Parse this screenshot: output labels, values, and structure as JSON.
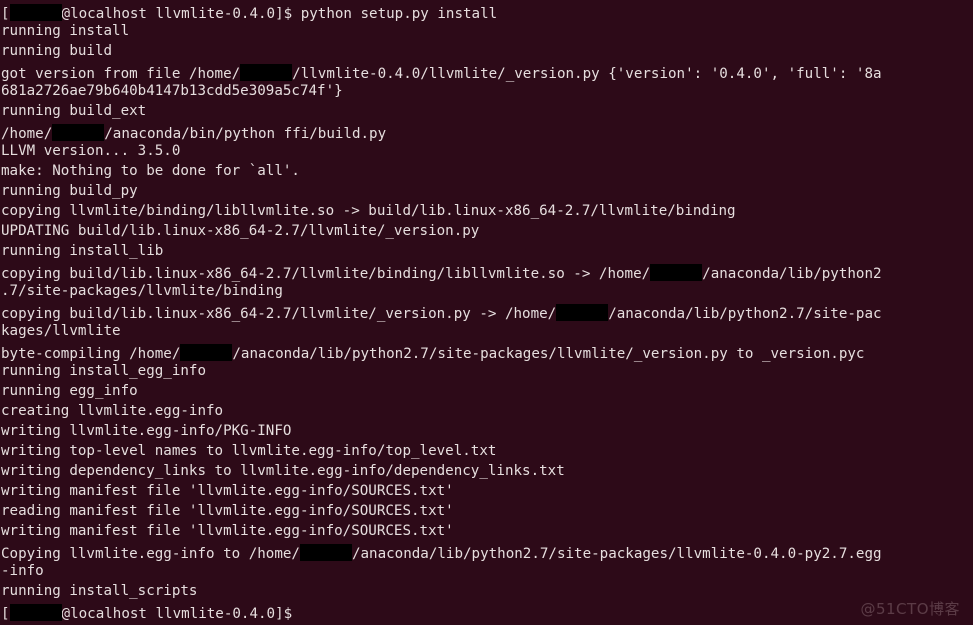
{
  "terminal": {
    "background_color": "#2d0a18",
    "text_color": "#e6dede",
    "redaction_color": "#000000",
    "hostname": "localhost",
    "working_directory": "llvmlite-0.4.0",
    "prompt_symbol": "$",
    "command": "python setup.py install",
    "font_size_px": 14,
    "line_height_px": 20,
    "columns": 107,
    "rows": 31,
    "lines": [
      {
        "id": "l01",
        "type": "prompt",
        "pre": "[",
        "redact_width": 52,
        "post": "@localhost llvmlite-0.4.0]$ python setup.py install"
      },
      {
        "id": "l02",
        "type": "output",
        "text": "running install"
      },
      {
        "id": "l03",
        "type": "output",
        "text": "running build"
      },
      {
        "id": "l04",
        "type": "output-redacted",
        "pre": "got version from file /home/",
        "redact_width": 52,
        "post": "/llvmlite-0.4.0/llvmlite/_version.py {'version': '0.4.0', 'full': '8a"
      },
      {
        "id": "l05",
        "type": "output",
        "text": "681a2726ae79b640b4147b13cdd5e309a5c74f'}"
      },
      {
        "id": "l06",
        "type": "output",
        "text": "running build_ext"
      },
      {
        "id": "l07",
        "type": "output-redacted",
        "pre": "/home/",
        "redact_width": 52,
        "post": "/anaconda/bin/python ffi/build.py"
      },
      {
        "id": "l08",
        "type": "output",
        "text": "LLVM version... 3.5.0"
      },
      {
        "id": "l09",
        "type": "output",
        "text": "make: Nothing to be done for `all'."
      },
      {
        "id": "l10",
        "type": "output",
        "text": "running build_py"
      },
      {
        "id": "l11",
        "type": "output",
        "text": "copying llvmlite/binding/libllvmlite.so -> build/lib.linux-x86_64-2.7/llvmlite/binding"
      },
      {
        "id": "l12",
        "type": "output",
        "text": "UPDATING build/lib.linux-x86_64-2.7/llvmlite/_version.py"
      },
      {
        "id": "l13",
        "type": "output",
        "text": "running install_lib"
      },
      {
        "id": "l14",
        "type": "output-redacted",
        "pre": "copying build/lib.linux-x86_64-2.7/llvmlite/binding/libllvmlite.so -> /home/",
        "redact_width": 52,
        "post": "/anaconda/lib/python2"
      },
      {
        "id": "l15",
        "type": "output",
        "text": ".7/site-packages/llvmlite/binding"
      },
      {
        "id": "l16",
        "type": "output-redacted",
        "pre": "copying build/lib.linux-x86_64-2.7/llvmlite/_version.py -> /home/",
        "redact_width": 52,
        "post": "/anaconda/lib/python2.7/site-pac"
      },
      {
        "id": "l17",
        "type": "output",
        "text": "kages/llvmlite"
      },
      {
        "id": "l18",
        "type": "output-redacted",
        "pre": "byte-compiling /home/",
        "redact_width": 52,
        "post": "/anaconda/lib/python2.7/site-packages/llvmlite/_version.py to _version.pyc"
      },
      {
        "id": "l19",
        "type": "output",
        "text": "running install_egg_info"
      },
      {
        "id": "l20",
        "type": "output",
        "text": "running egg_info"
      },
      {
        "id": "l21",
        "type": "output",
        "text": "creating llvmlite.egg-info"
      },
      {
        "id": "l22",
        "type": "output",
        "text": "writing llvmlite.egg-info/PKG-INFO"
      },
      {
        "id": "l23",
        "type": "output",
        "text": "writing top-level names to llvmlite.egg-info/top_level.txt"
      },
      {
        "id": "l24",
        "type": "output",
        "text": "writing dependency_links to llvmlite.egg-info/dependency_links.txt"
      },
      {
        "id": "l25",
        "type": "output",
        "text": "writing manifest file 'llvmlite.egg-info/SOURCES.txt'"
      },
      {
        "id": "l26",
        "type": "output",
        "text": "reading manifest file 'llvmlite.egg-info/SOURCES.txt'"
      },
      {
        "id": "l27",
        "type": "output",
        "text": "writing manifest file 'llvmlite.egg-info/SOURCES.txt'"
      },
      {
        "id": "l28",
        "type": "output-redacted",
        "pre": "Copying llvmlite.egg-info to /home/",
        "redact_width": 52,
        "post": "/anaconda/lib/python2.7/site-packages/llvmlite-0.4.0-py2.7.egg"
      },
      {
        "id": "l29",
        "type": "output",
        "text": "-info"
      },
      {
        "id": "l30",
        "type": "output",
        "text": "running install_scripts"
      },
      {
        "id": "l31",
        "type": "prompt",
        "pre": "[",
        "redact_width": 52,
        "post": "@localhost llvmlite-0.4.0]$"
      }
    ]
  },
  "watermark": {
    "text": "@51CTO博客"
  }
}
